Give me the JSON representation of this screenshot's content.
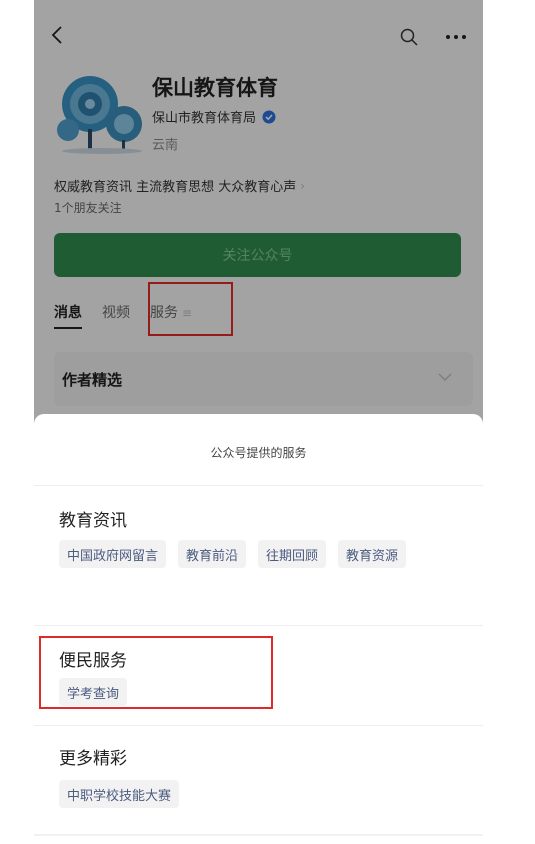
{
  "account": {
    "name": "保山教育体育",
    "org": "保山市教育体育局",
    "region": "云南",
    "description": "权威教育资讯 主流教育思想 大众教育心声",
    "friends": "1个朋友关注",
    "follow_label": "关注公众号"
  },
  "tabs": [
    {
      "label": "消息"
    },
    {
      "label": "视频"
    },
    {
      "label": "服务"
    }
  ],
  "author_section": {
    "title": "作者精选"
  },
  "sheet": {
    "title": "公众号提供的服务",
    "sections": [
      {
        "title": "教育资讯",
        "items": [
          "中国政府网留言",
          "教育前沿",
          "往期回顾",
          "教育资源"
        ]
      },
      {
        "title": "便民服务",
        "items": [
          "学考查询"
        ]
      },
      {
        "title": "更多精彩",
        "items": [
          "中职学校技能大赛"
        ]
      }
    ]
  },
  "colors": {
    "follow_button": "#2f8a4e",
    "highlight": "#e02a2a",
    "chip_text": "#4c5a80"
  }
}
